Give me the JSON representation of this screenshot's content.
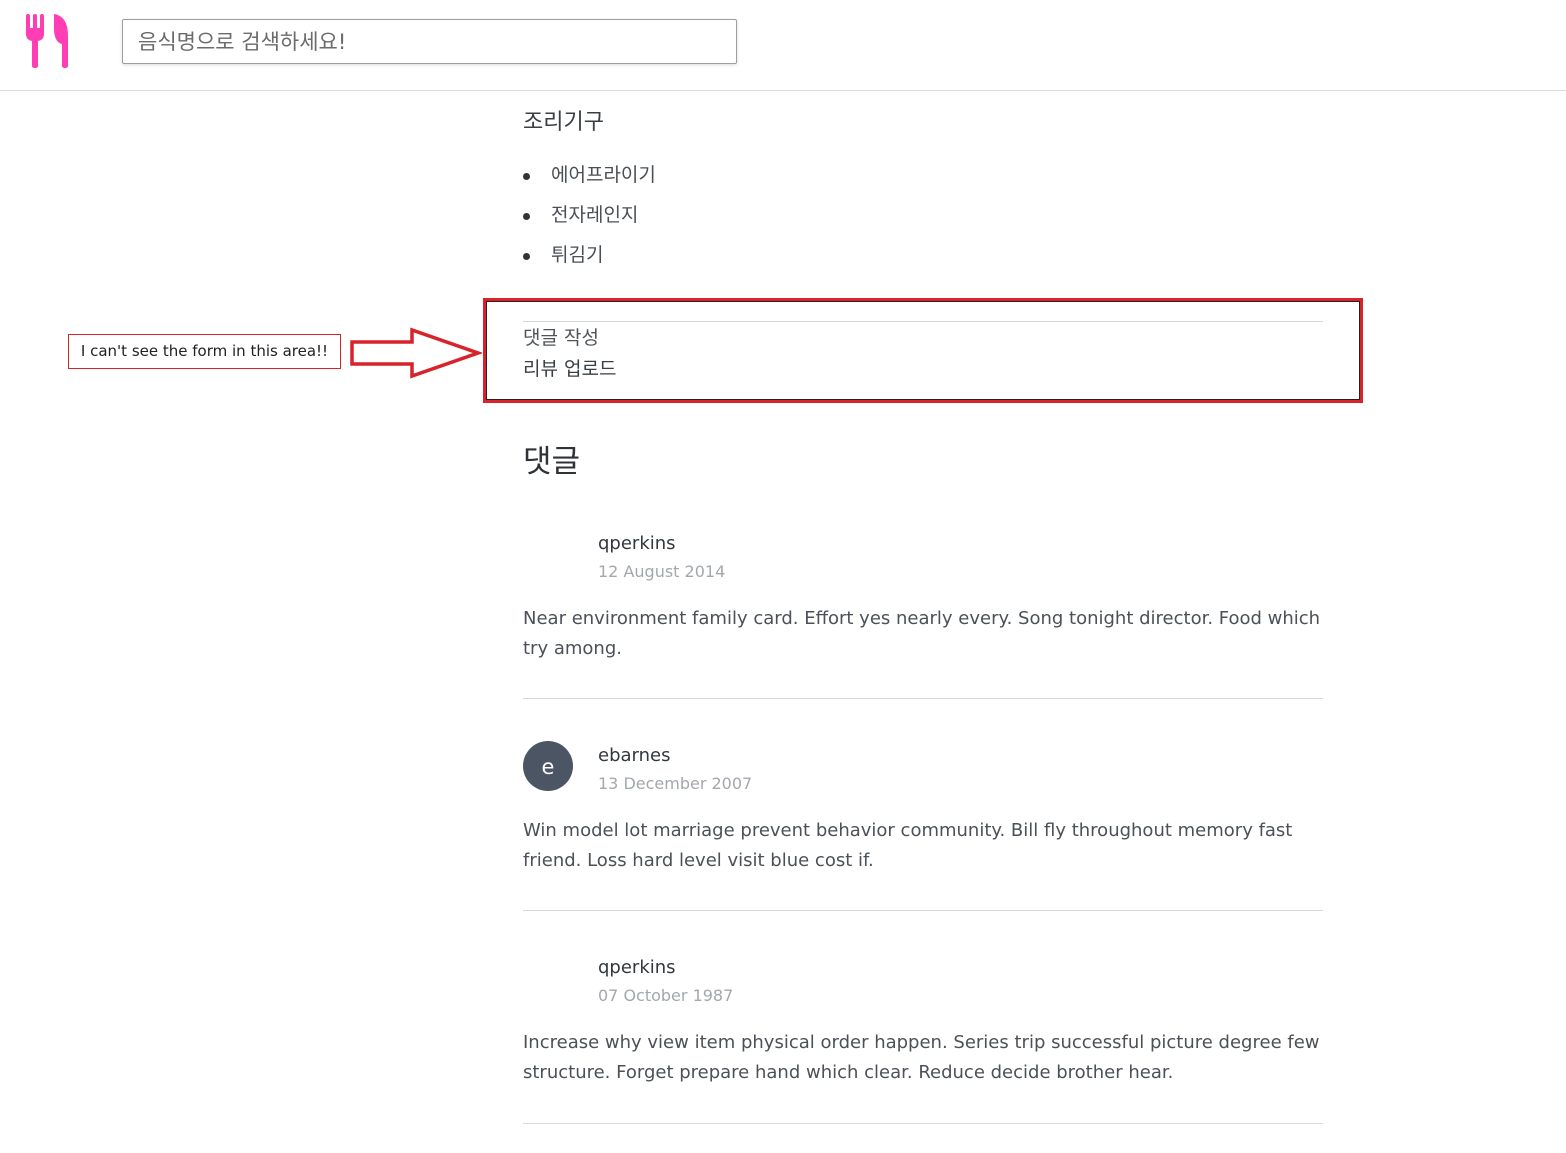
{
  "header": {
    "search_placeholder": "음식명으로 검색하세요!",
    "logo_icon": "fork-spoon-icon",
    "logo_color": "#ff3db4"
  },
  "tools": {
    "title": "조리기구",
    "items": [
      "에어프라이기",
      "전자레인지",
      "튀김기"
    ]
  },
  "comment_form": {
    "label": "댓글 작성",
    "upload_label": "리뷰 업로드"
  },
  "annotation": {
    "note": "I can't see the form in this area!!",
    "color": "#d8232a"
  },
  "comments": {
    "title": "댓글",
    "items": [
      {
        "avatar": "",
        "author": "qperkins",
        "date": "12 August 2014",
        "body": "Near environment family card. Effort yes nearly every. Song tonight director. Food which try among."
      },
      {
        "avatar": "e",
        "author": "ebarnes",
        "date": "13 December 2007",
        "body": "Win model lot marriage prevent behavior community. Bill fly throughout memory fast friend. Loss hard level visit blue cost if."
      },
      {
        "avatar": "",
        "author": "qperkins",
        "date": "07 October 1987",
        "body": "Increase why view item physical order happen. Series trip successful picture degree few structure. Forget prepare hand which clear. Reduce decide brother hear."
      }
    ]
  }
}
